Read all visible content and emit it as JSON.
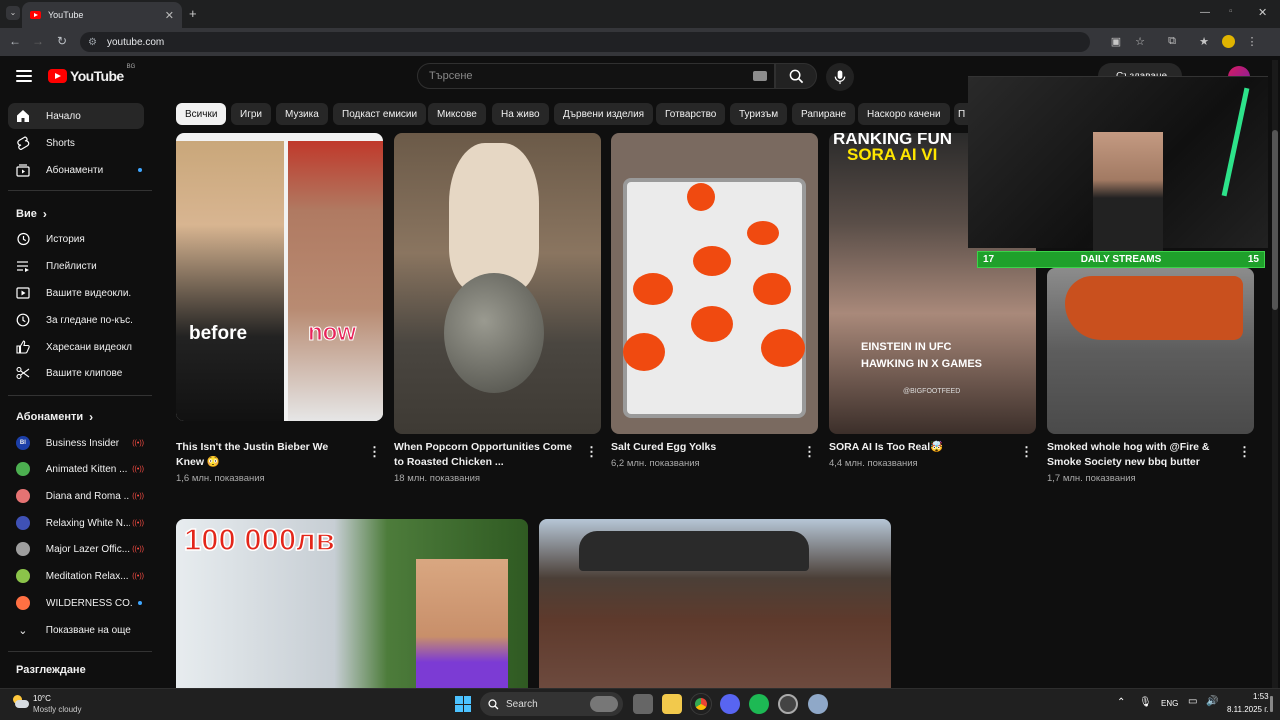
{
  "browser": {
    "tab_title": "YouTube",
    "url": "youtube.com"
  },
  "header": {
    "logo_text": "YouTube",
    "region": "BG",
    "search_placeholder": "Търсене",
    "create_label": "Създаване"
  },
  "sidebar": {
    "main": [
      {
        "label": "Начало",
        "icon": "home-icon"
      },
      {
        "label": "Shorts",
        "icon": "shorts-icon"
      },
      {
        "label": "Абонаменти",
        "icon": "subscriptions-icon"
      }
    ],
    "you_header": "Вие",
    "you": [
      {
        "label": "История",
        "icon": "history-icon"
      },
      {
        "label": "Плейлисти",
        "icon": "playlists-icon"
      },
      {
        "label": "Вашите видеокли...",
        "icon": "your-videos-icon"
      },
      {
        "label": "За гледане по-къс...",
        "icon": "watch-later-icon"
      },
      {
        "label": "Харесани видеокл...",
        "icon": "liked-icon"
      },
      {
        "label": "Вашите клипове",
        "icon": "clips-icon"
      }
    ],
    "subs_header": "Абонаменти",
    "subscriptions": [
      {
        "label": "Business Insider",
        "color": "#1c3fa8",
        "badge": "BI"
      },
      {
        "label": "Animated Kitten ...",
        "color": "#4caf50"
      },
      {
        "label": "Diana and Roma ...",
        "color": "#e57373"
      },
      {
        "label": "Relaxing White N...",
        "color": "#3f51b5"
      },
      {
        "label": "Major Lazer Offic...",
        "color": "#9e9e9e"
      },
      {
        "label": "Meditation Relax...",
        "color": "#8bc34a"
      },
      {
        "label": "WILDERNESS CO...",
        "color": "#ff7043"
      }
    ],
    "show_more": "Показване на още",
    "explore_header": "Разглеждане"
  },
  "chips": [
    "Всички",
    "Игри",
    "Музика",
    "Подкаст емисии",
    "Миксове",
    "На живо",
    "Дървени изделия",
    "Готварство",
    "Туризъм",
    "Рапиране",
    "Наскоро качени",
    "П"
  ],
  "videos": [
    {
      "title": "This Isn't the Justin Bieber We Knew 😳",
      "views": "1,6 млн. показвания",
      "overlay_left": "before",
      "overlay_right": "now"
    },
    {
      "title": "When Popcorn Opportunities Come to Roasted Chicken ...",
      "views": "18 млн. показвания"
    },
    {
      "title": "Salt Cured Egg Yolks",
      "views": "6,2 млн. показвания"
    },
    {
      "title": "SORA AI Is Too Real🤯",
      "views": "4,4 млн. показвания",
      "overlay_top1": "RANKING FUN",
      "overlay_top2": "SORA AI VI",
      "overlay_mid1": "EINSTEIN IN UFC",
      "overlay_mid2": "HAWKING IN X GAMES",
      "watermark": "@BIGFOOTFEED"
    },
    {
      "title": "Smoked whole hog with @Fire & Smoke Society new bbq butter",
      "views": "1,7 млн. показвания"
    }
  ],
  "row2": [
    {
      "overlay": "100 000лв"
    },
    {}
  ],
  "overlay": {
    "left_num": "17",
    "label": "DAILY STREAMS",
    "right_num": "15"
  },
  "taskbar": {
    "temp": "10°C",
    "weather": "Mostly cloudy",
    "search": "Search",
    "lang": "ENG",
    "time": "1:53",
    "date": "8.11.2025 г."
  }
}
